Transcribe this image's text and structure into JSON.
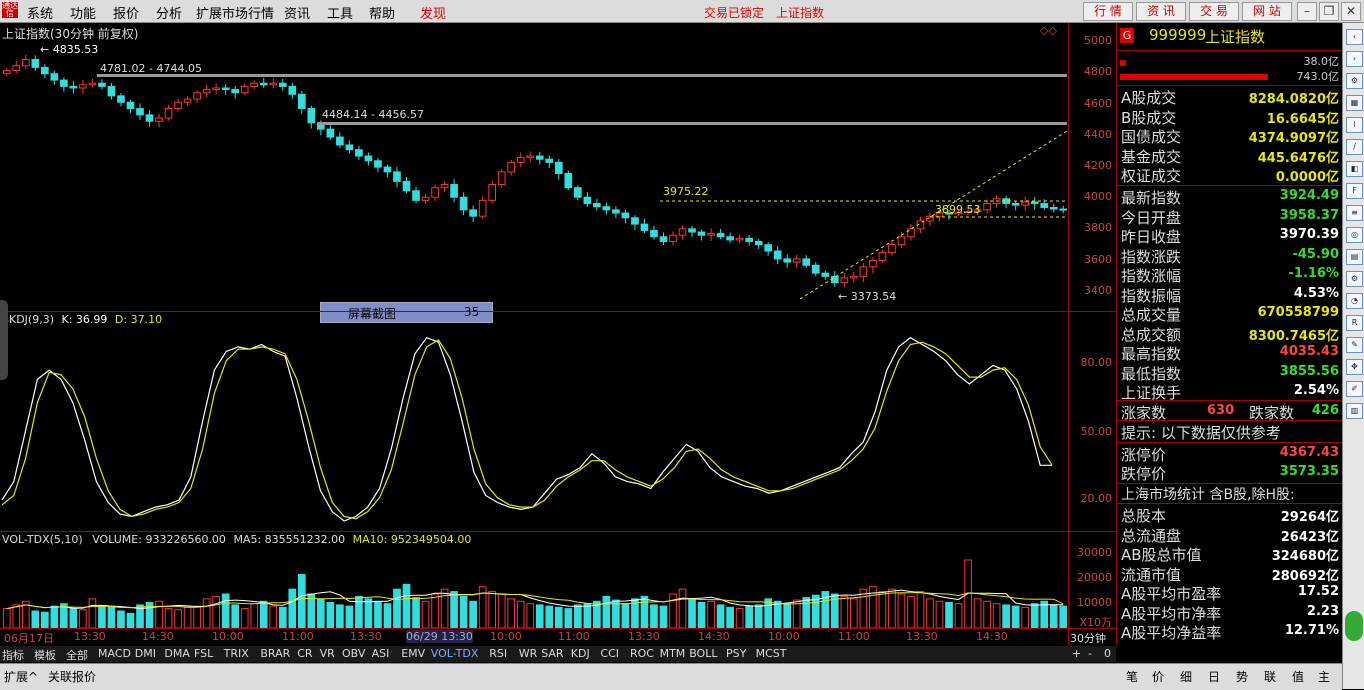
{
  "menu": {
    "items": [
      "系统",
      "功能",
      "报价",
      "分析",
      "扩展市场行情",
      "资讯",
      "工具",
      "帮助"
    ],
    "discover": "发现",
    "status_lock": "交易已锁定",
    "index_name": "上证指数",
    "buttons": [
      "行 情",
      "资 讯",
      "交 易",
      "网 站"
    ]
  },
  "main_chart": {
    "title": "上证指数(30分钟 前复权)",
    "price_axis": [
      "5000",
      "4800",
      "4600",
      "4400",
      "4200",
      "4000",
      "3800",
      "3600",
      "3400"
    ],
    "annotations": {
      "high": "4835.53",
      "band1": "4781.02 - 4744.05",
      "band2": "4484.14 - 4456.57",
      "peak2": "3975.22",
      "level3": "3899.53",
      "low": "3373.54"
    }
  },
  "chart_data": [
    {
      "type": "candlestick",
      "title": "上证指数(30分钟 前复权)",
      "ylim": [
        3300,
        5050
      ],
      "close": [
        4800,
        4830,
        4870,
        4820,
        4780,
        4740,
        4700,
        4690,
        4710,
        4720,
        4700,
        4640,
        4600,
        4560,
        4520,
        4480,
        4500,
        4560,
        4600,
        4620,
        4660,
        4680,
        4690,
        4680,
        4660,
        4700,
        4720,
        4710,
        4720,
        4700,
        4650,
        4560,
        4470,
        4430,
        4380,
        4330,
        4300,
        4260,
        4230,
        4190,
        4160,
        4100,
        4040,
        3980,
        4000,
        4060,
        4080,
        4000,
        3920,
        3880,
        3980,
        4080,
        4160,
        4220,
        4250,
        4260,
        4240,
        4220,
        4150,
        4060,
        4000,
        3960,
        3940,
        3920,
        3900,
        3870,
        3830,
        3790,
        3750,
        3720,
        3760,
        3800,
        3780,
        3760,
        3770,
        3750,
        3730,
        3740,
        3720,
        3700,
        3660,
        3610,
        3590,
        3610,
        3570,
        3520,
        3500,
        3460,
        3490,
        3500,
        3560,
        3600,
        3650,
        3700,
        3750,
        3800,
        3850,
        3880,
        3900,
        3895,
        3905,
        3910,
        3920,
        3960,
        3990,
        3960,
        3950,
        3970,
        3960,
        3935,
        3925,
        3920
      ]
    },
    {
      "type": "line",
      "title": "SKDJ(9,3)",
      "ylim": [
        10,
        100
      ],
      "series": [
        {
          "name": "K",
          "values": [
            22,
            30,
            52,
            74,
            78,
            74,
            64,
            48,
            30,
            21,
            16,
            15,
            17,
            19,
            20,
            22,
            32,
            56,
            78,
            86,
            88,
            87,
            89,
            86,
            84,
            66,
            45,
            26,
            17,
            13,
            15,
            19,
            27,
            44,
            66,
            85,
            92,
            90,
            76,
            56,
            34,
            24,
            21,
            19,
            18,
            19,
            25,
            31,
            33,
            36,
            42,
            38,
            32,
            30,
            29,
            27,
            34,
            40,
            46,
            43,
            36,
            32,
            30,
            28,
            27,
            25,
            26,
            28,
            30,
            32,
            34,
            36,
            42,
            47,
            60,
            78,
            88,
            92,
            89,
            86,
            82,
            76,
            72,
            76,
            80,
            78,
            70,
            56,
            37,
            36.99
          ]
        },
        {
          "name": "D",
          "values": [
            20,
            24,
            40,
            64,
            77,
            76,
            70,
            58,
            40,
            26,
            18,
            15,
            16,
            18,
            19,
            21,
            27,
            44,
            68,
            82,
            87,
            87,
            88,
            87,
            85,
            74,
            56,
            36,
            21,
            15,
            14,
            17,
            23,
            35,
            55,
            76,
            88,
            91,
            83,
            66,
            44,
            29,
            23,
            20,
            19,
            19,
            22,
            28,
            32,
            35,
            39,
            39,
            35,
            32,
            30,
            28,
            31,
            36,
            43,
            44,
            40,
            35,
            32,
            30,
            28,
            26,
            26,
            27,
            29,
            31,
            33,
            35,
            39,
            44,
            53,
            69,
            82,
            89,
            90,
            88,
            85,
            80,
            75,
            75,
            78,
            79,
            74,
            63,
            45,
            37.1
          ]
        }
      ]
    },
    {
      "type": "bar",
      "title": "VOL-TDX(5,10)",
      "ylim": [
        0,
        35000
      ],
      "ylabel": "X10万",
      "values": [
        8000,
        9500,
        11000,
        7000,
        6500,
        9000,
        10000,
        8000,
        7500,
        12000,
        9000,
        8500,
        7000,
        6000,
        9500,
        10500,
        11000,
        8000,
        7500,
        8500,
        9000,
        12000,
        13000,
        14000,
        9500,
        8000,
        10000,
        11000,
        9000,
        8500,
        16000,
        22000,
        14000,
        12000,
        10500,
        9500,
        9000,
        13000,
        12000,
        11000,
        10000,
        16000,
        18000,
        12500,
        11000,
        14000,
        16000,
        15000,
        13000,
        11000,
        17000,
        15000,
        14000,
        12000,
        11000,
        10000,
        9500,
        9000,
        8500,
        8000,
        9500,
        10000,
        11000,
        13000,
        11500,
        10000,
        12000,
        13000,
        9500,
        9000,
        14000,
        16000,
        12000,
        10500,
        11000,
        9500,
        8500,
        8000,
        9000,
        9500,
        12000,
        11000,
        10000,
        11500,
        12500,
        13500,
        15000,
        14000,
        13000,
        12000,
        16000,
        17000,
        15000,
        16000,
        14000,
        13000,
        15000,
        12000,
        11000,
        10500,
        10000,
        28000,
        12000,
        11000,
        10000,
        9500,
        9000,
        8500,
        10000,
        11000,
        9500,
        9000
      ]
    }
  ],
  "skdj": {
    "title": "SKDJ(9,3)",
    "k_label": "K: 36.99",
    "d_label": "D: 37.10",
    "axis": [
      "80.00",
      "50.00",
      "20.00"
    ]
  },
  "volume": {
    "title": "VOL-TDX(5,10)",
    "volume_label": "VOLUME: 933226560.00",
    "ma5_label": "MA5: 835551232.00",
    "ma10_label": "MA10: 952349504.00",
    "axis": [
      "30000",
      "20000",
      "10000"
    ],
    "unit": "X10万"
  },
  "overlay": {
    "label": "屏幕截图",
    "value": "35"
  },
  "time_axis": [
    "06月17日",
    "13:30",
    "14:30",
    "10:00",
    "11:00",
    "13:30",
    "06/29 13:30",
    "10:00",
    "11:00",
    "13:30",
    "14:30",
    "10:00",
    "11:00",
    "13:30",
    "14:30"
  ],
  "period": "30分钟",
  "tabs": [
    "指标",
    "模板",
    "全部",
    "MACD",
    "DMI",
    "DMA",
    "FSL",
    "TRIX",
    "BRAR",
    "CR",
    "VR",
    "OBV",
    "ASI",
    "EMV",
    "VOL-TDX",
    "RSI",
    "WR",
    "SAR",
    "KDJ",
    "CCI",
    "ROC",
    "MTM",
    "BOLL",
    "PSY",
    "MCST"
  ],
  "tab_controls": [
    "+",
    "-",
    "0"
  ],
  "bottom": {
    "left": [
      "扩展^",
      "关联报价"
    ],
    "right": [
      "笔",
      "价",
      "细",
      "日",
      "势",
      "联",
      "值",
      "主"
    ]
  },
  "rpanel": {
    "badge": "G",
    "code": "999999",
    "name": "上证指数",
    "bar_top": "38.0亿",
    "bar_bottom": "743.0亿",
    "rows1": [
      {
        "k": "A股成交",
        "v": "8284.0820亿",
        "c": "#e8e800"
      },
      {
        "k": "B股成交",
        "v": "16.6645亿",
        "c": "#e8e800"
      },
      {
        "k": "国债成交",
        "v": "4374.9097亿",
        "c": "#e8e800"
      },
      {
        "k": "基金成交",
        "v": "445.6476亿",
        "c": "#e8e800"
      },
      {
        "k": "权证成交",
        "v": "0.0000亿",
        "c": "#e8e800"
      }
    ],
    "rows2": [
      {
        "k": "最新指数",
        "v": "3924.49",
        "c": "#33dd33"
      },
      {
        "k": "今日开盘",
        "v": "3958.37",
        "c": "#33dd33"
      },
      {
        "k": "昨日收盘",
        "v": "3970.39",
        "c": "#ffffff"
      },
      {
        "k": "指数涨跌",
        "v": "-45.90",
        "c": "#33dd33"
      },
      {
        "k": "指数涨幅",
        "v": "-1.16%",
        "c": "#33dd33"
      },
      {
        "k": "指数振幅",
        "v": "4.53%",
        "c": "#ffffff"
      },
      {
        "k": "总成交量",
        "v": "670558799",
        "c": "#e8e800"
      },
      {
        "k": "总成交额",
        "v": "8300.7465亿",
        "c": "#e8e800"
      },
      {
        "k": "最高指数",
        "v": "4035.43",
        "c": "#ff4444"
      },
      {
        "k": "最低指数",
        "v": "3855.56",
        "c": "#33dd33"
      },
      {
        "k": "上证换手",
        "v": "2.54%",
        "c": "#ffffff"
      }
    ],
    "up_label": "涨家数",
    "up_value": "630",
    "down_label": "跌家数",
    "down_value": "426",
    "hint": "提示: 以下数据仅供参考",
    "limit_up_label": "涨停价",
    "limit_up": "4367.43",
    "limit_down_label": "跌停价",
    "limit_down": "3573.35",
    "stats_title": "上海市场统计 含B股,除H股:",
    "rows3": [
      {
        "k": "总股本",
        "v": "29264亿"
      },
      {
        "k": "总流通盘",
        "v": "26423亿"
      },
      {
        "k": "AB股总市值",
        "v": "324680亿"
      },
      {
        "k": "流通市值",
        "v": "280692亿"
      },
      {
        "k": "A股平均市盈率",
        "v": "17.52"
      },
      {
        "k": "A股平均市净率",
        "v": "2.23"
      },
      {
        "k": "A股平均净益率",
        "v": "12.71%"
      }
    ]
  },
  "colors": {
    "up": "#ff3333",
    "down": "#33dddd",
    "k": "#ffffff",
    "d": "#e8e800",
    "axis": "#cc4444"
  },
  "toolbar_icons": [
    "arrow-left-icon",
    "arrow-right-icon",
    "settings-icon",
    "grid-icon",
    "chart-icon",
    "line-icon",
    "cube-icon",
    "f10-icon",
    "list-icon",
    "globe-icon",
    "book-icon",
    "gear-icon",
    "pie-icon",
    "rsi-icon",
    "pen-icon",
    "move-icon",
    "edit-icon",
    "table-icon"
  ]
}
